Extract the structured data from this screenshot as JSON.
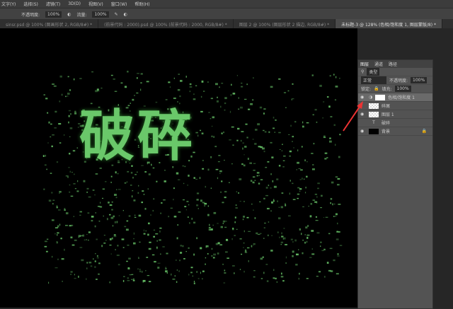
{
  "menu": [
    "文字(Y)",
    "选择(S)",
    "滤镜(T)",
    "3D(D)",
    "视图(V)",
    "窗口(W)",
    "帮助(H)"
  ],
  "options": {
    "opacity_label": "不透明度:",
    "opacity": "100%",
    "flow_label": "流量:",
    "flow": "100%"
  },
  "tabs": [
    "sinsr.psd @ 100% (图画形状 2, RGB/8#) *",
    "(前景代码 : 2000).psd @ 100% (前景代码 : 2000, RGB/8#) *",
    "图层 2 @ 100% (图层形状 2 描边, RGB/8#) *",
    "未标题-3 @ 128% (色相/饱和度 1, 图层蒙版/8) *"
  ],
  "canvas": {
    "text": "破碎",
    "color": "#6ac86a"
  },
  "layers_panel": {
    "tabs": [
      "图层",
      "通道",
      "路径"
    ],
    "filter": "类型",
    "blend": "正常",
    "opacity_label": "不透明度:",
    "opacity": "100%",
    "lock_label": "锁定:",
    "fill_label": "填充:",
    "fill": "100%",
    "layers": [
      {
        "name": "色相/饱和度 1"
      },
      {
        "name": "碎屑"
      },
      {
        "name": "图层 1"
      },
      {
        "name": "破碎"
      },
      {
        "name": "背景"
      }
    ]
  }
}
